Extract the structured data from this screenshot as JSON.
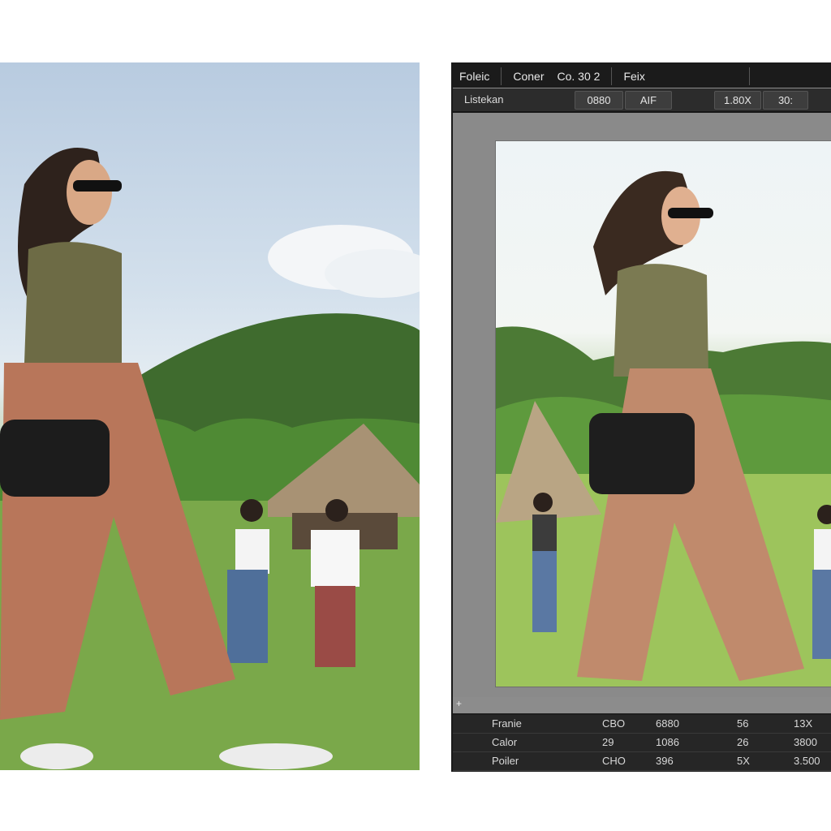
{
  "menubar": {
    "items": [
      "Foleic",
      "Coner",
      "Co. 30 2",
      "Feix"
    ]
  },
  "toolbar": {
    "label": "Listekan",
    "field_a": "0880",
    "field_b": "AIF",
    "zoom": "1.80X",
    "field_c": "30:"
  },
  "canvas": {
    "cursor_glyph": "+"
  },
  "info": {
    "rows": [
      [
        "Franie",
        "CBO",
        "6880",
        "56",
        "13X"
      ],
      [
        "Calor",
        "29",
        "1086",
        "26",
        "3800"
      ],
      [
        "Poiler",
        "CHO",
        "396",
        "5X",
        "3.500"
      ]
    ]
  },
  "colors": {
    "menubar_bg": "#1b1b1b",
    "toolbar_bg": "#2c2c2c",
    "canvas_bg": "#8a8a8a"
  }
}
